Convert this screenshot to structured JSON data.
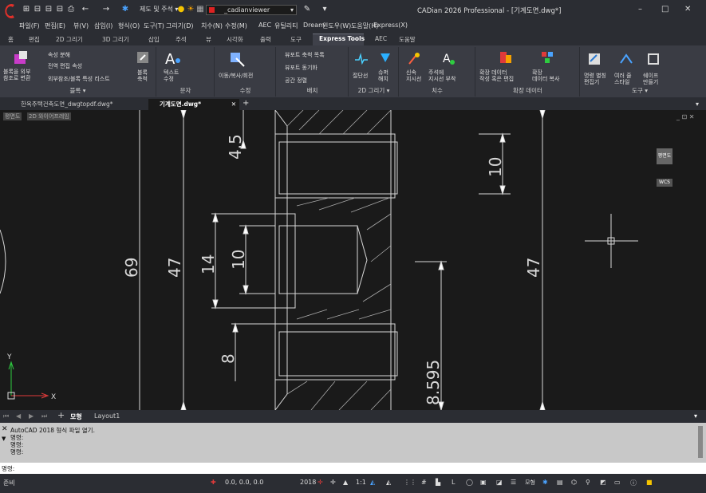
{
  "titlebar": {
    "quick_access_mode": "제도 및 주석",
    "layer_name": "_cadianviewer",
    "window_title": "CADian 2026 Professional - [기계도면.dwg*]",
    "minimize_icon": "minimize-icon",
    "maximize_icon": "maximize-icon",
    "close_icon": "close-icon"
  },
  "menubar": [
    "파일(F)",
    "편집(E)",
    "뷰(V)",
    "삽입(I)",
    "형식(O)",
    "도구(T)",
    "그리기(D)",
    "치수(N)",
    "수정(M)",
    "AEC",
    "유틸리티",
    "Dream",
    "윈도우(W)",
    "도움말(H)",
    "Express(X)"
  ],
  "ribbon_tabs": [
    "홈",
    "편집",
    "2D 그리기",
    "3D 그리기",
    "삽입",
    "주석",
    "뷰",
    "시각화",
    "출력",
    "도구",
    "Express Tools",
    "AEC",
    "도움말"
  ],
  "ribbon_active_tab": "Express Tools",
  "ribbon": {
    "block": {
      "label": "블록",
      "btn_attach": "블록을 외부\n참조로 변환",
      "btn_explode_attr": "속성 분해",
      "btn_global_edit": "전역 편집 속성",
      "btn_xref_list": "외부참조/블록 특성 리스트",
      "btn_block_count": "블록\n축척"
    },
    "text": {
      "label": "문자",
      "btn_modify": "텍스트\n수정"
    },
    "modify": {
      "label": "수정",
      "btn_move_copy": "이동/복사/회전"
    },
    "layout": {
      "label": "배치",
      "btn_viewport_scale": "뷰포트 축척 목록",
      "btn_viewport_sync": "뷰포트 동기화",
      "btn_space": "공간 정렬"
    },
    "draw2d": {
      "label": "2D 그리기",
      "btn_break": "절단선",
      "btn_super_hatch": "슈퍼\n해치"
    },
    "dim": {
      "label": "치수",
      "btn_leader": "신속\n지시선",
      "btn_attach_leader": "주석에\n지시선 부착"
    },
    "xdata": {
      "label": "확장 데이터",
      "btn_edit": "확장 데이터\n작성 혹은 편집",
      "btn_copy": "확장\n데이터 복사"
    },
    "tools": {
      "label": "도구",
      "btn_cmd_alias": "명령 별칭\n편집기",
      "btn_multi_style": "여러 줄\n스타일",
      "btn_shape": "쉐이프\n만들기"
    }
  },
  "doc_tabs": [
    "한옥주택건축도면_dwgtopdf.dwg*",
    "기계도면.dwg*"
  ],
  "doc_tab_active": "기계도면.dwg*",
  "canvas": {
    "viewport_labels": [
      "평면도",
      "2D 와이어프레임"
    ],
    "dims": [
      "4.5",
      "69",
      "47",
      "14",
      "10",
      "8",
      "8.595",
      "10",
      "47"
    ],
    "ucs_x": "X",
    "ucs_y": "Y",
    "viewcube_top": "평면도",
    "viewcube_wcs": "WCS"
  },
  "bottom_tabs": [
    "모형",
    "Layout1"
  ],
  "command_history": [
    "AutoCAD 2018 형식 파일 열기.",
    "명령:",
    "명령:",
    "명령:"
  ],
  "command_prompt": "명령:",
  "statusbar": {
    "ready": "준비",
    "coords": "0.0, 0.0, 0.0",
    "year": "2018",
    "scale": "1:1",
    "model": "모형"
  },
  "colors": {
    "accent": "#2b79d0",
    "bg": "#1a1a1a",
    "chrome": "#2b2d33",
    "ribbon": "#3a3c44"
  }
}
